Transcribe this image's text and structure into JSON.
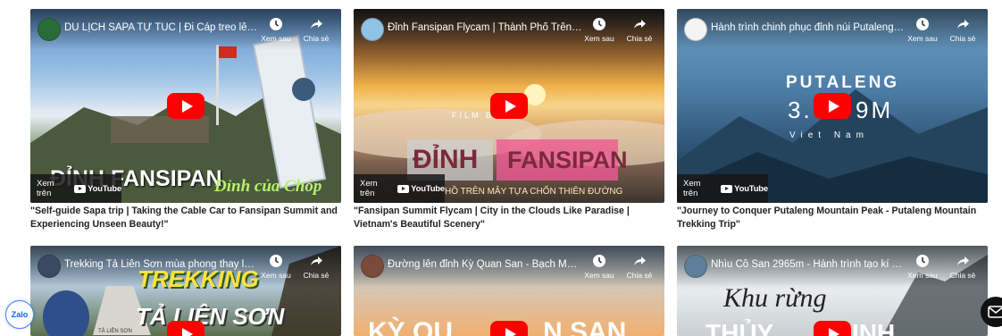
{
  "actions": {
    "watch_later": "Xem sau",
    "share": "Chia sẻ",
    "watch_on": "Xem trên",
    "youtube": "YouTube"
  },
  "videos": [
    {
      "title": "DU LỊCH SAPA TỰ TÚC | Đi Cáp treo lên Đỉnh...",
      "overlay": "ĐỈNH FANSIPAN",
      "overlay2": "Đỉnh của Chóp",
      "caption": "\"Self-guide Sapa trip | Taking the Cable Car to Fansipan Summit and Experiencing Unseen Beauty!\""
    },
    {
      "title": "Đỉnh Fansipan Flycam | Thành Phố Trên Mây...",
      "overlay": "ĐỈNH",
      "overlay2": "FANSIPAN",
      "overlay3": "HỒ TRÊN MÂY TỰA CHỐN THIÊN ĐƯỜNG",
      "overlay4": "FILM B",
      "caption": "\"Fansipan Summit Flycam | City in the Clouds Like Paradise | Vietnam's Beautiful Scenery\""
    },
    {
      "title": "Hành trình chinh phục đỉnh núi Putaleng - Pu...",
      "overlay": "PUTALENG",
      "overlay2": "3.",
      "overlay3": "9M",
      "overlay4": "Viet Nam",
      "caption": "\"Journey to Conquer Putaleng Mountain Peak - Putaleng Mountain Trekking Trip\""
    },
    {
      "title": "Trekking Tả Liên Sơn mùa phong thay lá - Ng...",
      "overlay": "TREKKING",
      "overlay2": "TẢ LIÊN SƠN",
      "overlay3": "TẢ LIÊN SƠN"
    },
    {
      "title": "Đường lên đỉnh Kỳ Quan San - Bạch Mộc Lư...",
      "overlay": "KỲ QU",
      "overlay2": "N SAN"
    },
    {
      "title": "Nhìu Cồ San 2965m - Hành trình tạo kí ức ch...",
      "overlay": "Khu rừng",
      "overlay2": "THỦY",
      "overlay3": "INH"
    }
  ],
  "widgets": {
    "zalo": "Zalo"
  }
}
